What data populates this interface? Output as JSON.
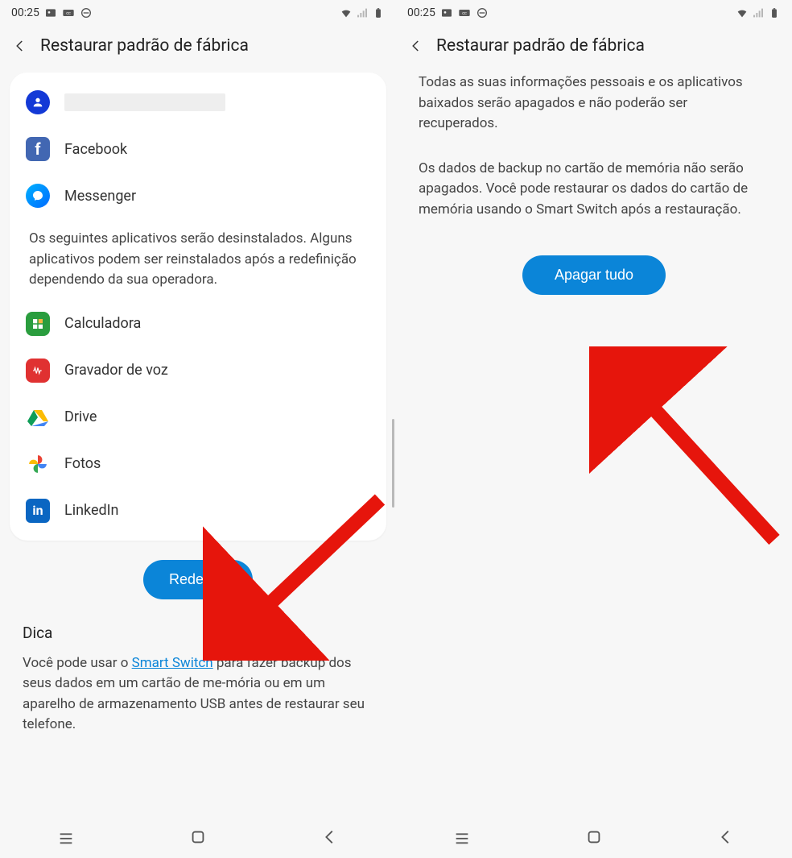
{
  "statusbar": {
    "time": "00:25",
    "icons_left": [
      "image-icon",
      "cc-icon",
      "minus-circle-icon"
    ],
    "icons_right": [
      "wifi-icon",
      "signal-icon",
      "battery-icon"
    ]
  },
  "left": {
    "header_title": "Restaurar padrão de fábrica",
    "apps_top": [
      {
        "name": "account_redacted",
        "label": ""
      },
      {
        "name": "facebook",
        "label": "Facebook"
      },
      {
        "name": "messenger",
        "label": "Messenger"
      }
    ],
    "mid_text": "Os seguintes aplicativos serão desinstalados. Alguns aplicativos podem ser reinstalados após a redefinição dependendo da sua operadora.",
    "apps_bottom": [
      {
        "name": "calculator",
        "label": "Calculadora"
      },
      {
        "name": "voicerecorder",
        "label": "Gravador de voz"
      },
      {
        "name": "drive",
        "label": "Drive"
      },
      {
        "name": "photos",
        "label": "Fotos"
      },
      {
        "name": "linkedin",
        "label": "LinkedIn"
      }
    ],
    "reset_button": "Redefinir",
    "tip_title": "Dica",
    "tip_text_before": "Você pode usar o ",
    "tip_link": "Smart Switch",
    "tip_text_after": " para fazer backup dos seus dados em um cartão de me-mória ou em um aparelho de armazenamento USB antes de restaurar seu telefone."
  },
  "right": {
    "header_title": "Restaurar padrão de fábrica",
    "para1": "Todas as suas informações pessoais e os aplicativos baixados serão apagados e não poderão ser recuperados.",
    "para2": "Os dados de backup no cartão de memória não serão apagados. Você pode restaurar os dados do cartão de memória usando o Smart Switch após a restauração.",
    "erase_button": "Apagar tudo"
  },
  "nav": {
    "recents": "recents-button",
    "home": "home-button",
    "back": "back-button"
  },
  "colors": {
    "primary": "#0b85d8",
    "arrow": "#e6150c"
  }
}
